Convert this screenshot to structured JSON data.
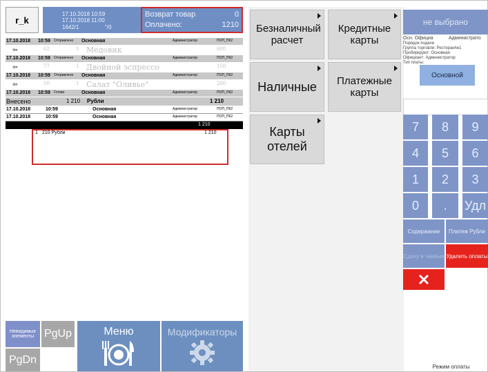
{
  "header": {
    "station": "r_k",
    "date1": "17.10.2018 10:59",
    "date2": "17.10.2018 11:00",
    "order": "1642/1",
    "order_suffix": "\"/0",
    "return_label": "Возврат товар",
    "return_value": "0",
    "paid_label": "Оплачено:",
    "paid_value": "1210"
  },
  "rows": [
    {
      "kind": "g",
      "date": "17.10.2018",
      "time": "10:59",
      "status": "Отправлено",
      "type": "Основная",
      "user": "Администратор",
      "code": "ПОП_ПК2"
    },
    {
      "kind": "w",
      "icon": "⇦",
      "qty": "62",
      "count": "1",
      "name": "Медовик",
      "price": "600"
    },
    {
      "kind": "g",
      "date": "17.10.2018",
      "time": "10:59",
      "status": "Отправлено",
      "type": "Основная",
      "user": "Администратор",
      "code": "ПОП_ПК2"
    },
    {
      "kind": "w",
      "icon": "⇦",
      "qty": "77",
      "count": "1",
      "name": "Двойной эспрессо",
      "price": "150"
    },
    {
      "kind": "g",
      "date": "17.10.2018",
      "time": "10:59",
      "status": "Отправлено",
      "type": "Основная",
      "user": "Администратор",
      "code": "ПОП_ПК2"
    },
    {
      "kind": "w",
      "icon": "⇦",
      "qty": "50",
      "count": "1",
      "name": "Салат \"Оливье\"",
      "price": "260"
    },
    {
      "kind": "g",
      "date": "17.10.2018",
      "time": "10:59",
      "status": "Готово",
      "type": "Основная",
      "user": "Администратор",
      "code": "ПОП_ПК2"
    }
  ],
  "deposit": {
    "label": "Внесено",
    "amount": "1 210",
    "currency": "Рубли",
    "total": "1 210"
  },
  "rows2": [
    {
      "date": "17.10.2018",
      "time": "10:59",
      "type": "Основная",
      "user": "Администратор",
      "code": "ПОП_ПК2"
    },
    {
      "date": "17.10.2018",
      "time": "10:59",
      "type": "Основная",
      "user": "Администратор",
      "code": "ПОП_ПК2"
    }
  ],
  "selected": {
    "total": "1 210"
  },
  "payment_line": {
    "count": "1",
    "text": "210 Рубли",
    "amount": "1  210"
  },
  "bottom_left": {
    "nevid": "Невидимые элементы",
    "pgup": "PgUp",
    "pgdn": "PgDn",
    "menu": "Меню",
    "mods": "Модификаторы"
  },
  "payments": [
    {
      "label": "Безналичный расчет"
    },
    {
      "label": "Кредитные карты"
    },
    {
      "label": "Наличные"
    },
    {
      "label": "Платежные карты"
    },
    {
      "label": "Карты отелей"
    }
  ],
  "right": {
    "not_selected": "не выбрано",
    "info_a1": "Осн. Официа",
    "info_a2": "Администрато",
    "info_lines": [
      "Порядок подачи",
      "Группа торговли: Ресторан№1",
      "Пробиркруют: Основная",
      "Официант: Администратор",
      "Тип платы:"
    ],
    "osn": "Основной",
    "keys": [
      "7",
      "8",
      "9",
      "4",
      "5",
      "6",
      "1",
      "2",
      "3",
      "0",
      ".",
      "Удл"
    ],
    "content_btn": "Содержание",
    "payment_rub": "Платеж Рубли",
    "change_btn": "Сдачу в чаевые",
    "delete_btn": "Удалить оплаты",
    "mode": "Режим оплаты"
  }
}
